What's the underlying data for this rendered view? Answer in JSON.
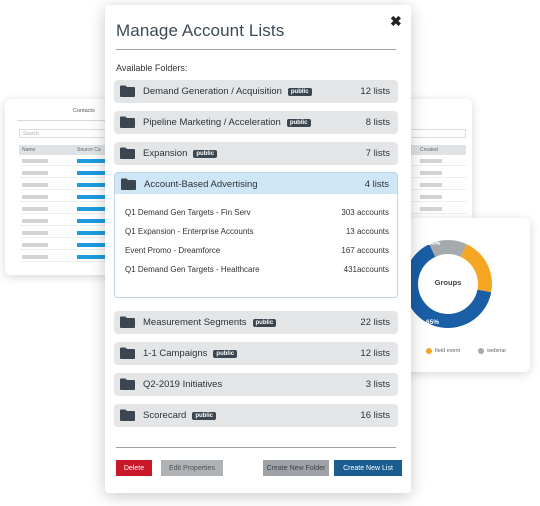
{
  "background_left": {
    "tab_label": "Contacts",
    "search_placeholder": "Search",
    "columns": [
      "Name",
      "Source Ca"
    ]
  },
  "background_right": {
    "column": "Created"
  },
  "donut": {
    "center_label": "Groups",
    "slices": [
      {
        "label": "14%",
        "value": 14,
        "color": "#a6a9ac"
      },
      {
        "label": "21%",
        "value": 21,
        "color": "#f5a623"
      },
      {
        "label": "65%",
        "value": 65,
        "color": "#1a5ea6"
      }
    ],
    "legend": [
      {
        "label": "field event",
        "color": "#f5a623"
      },
      {
        "label": "webinar",
        "color": "#a6a9ac"
      }
    ]
  },
  "dialog": {
    "title": "Manage Account Lists",
    "close_glyph": "✖",
    "available_label": "Available Folders:",
    "folders": [
      {
        "name": "Demand Generation / Acquisition",
        "public": true,
        "count": "12 lists"
      },
      {
        "name": "Pipeline Marketing / Acceleration",
        "public": true,
        "count": "8 lists"
      },
      {
        "name": "Expansion",
        "public": true,
        "count": "7 lists"
      },
      {
        "name": "Account-Based Advertising",
        "public": false,
        "count": "4 lists",
        "expanded": true
      },
      {
        "name": "Measurement Segments",
        "public": true,
        "count": "22 lists"
      },
      {
        "name": "1-1 Campaigns",
        "public": true,
        "count": "12 lists"
      },
      {
        "name": "Q2-2019 Initiatives",
        "public": false,
        "count": "3 lists"
      },
      {
        "name": "Scorecard",
        "public": true,
        "count": "16 lists"
      }
    ],
    "public_badge": "public",
    "expanded_lists": [
      {
        "name": "Q1 Demand Gen Targets - Fin Serv",
        "count": "303 accounts"
      },
      {
        "name": "Q1 Expansion - Enterprise Accounts",
        "count": "13 accounts"
      },
      {
        "name": "Event Promo - Dreamforce",
        "count": "167 accounts"
      },
      {
        "name": "Q1 Demand Gen Targets - Healthcare",
        "count": "431accounts"
      }
    ],
    "buttons": {
      "delete": "Delete",
      "edit": "Edit Properties",
      "create_folder": "Create New Folder",
      "create_list": "Create New List"
    }
  }
}
